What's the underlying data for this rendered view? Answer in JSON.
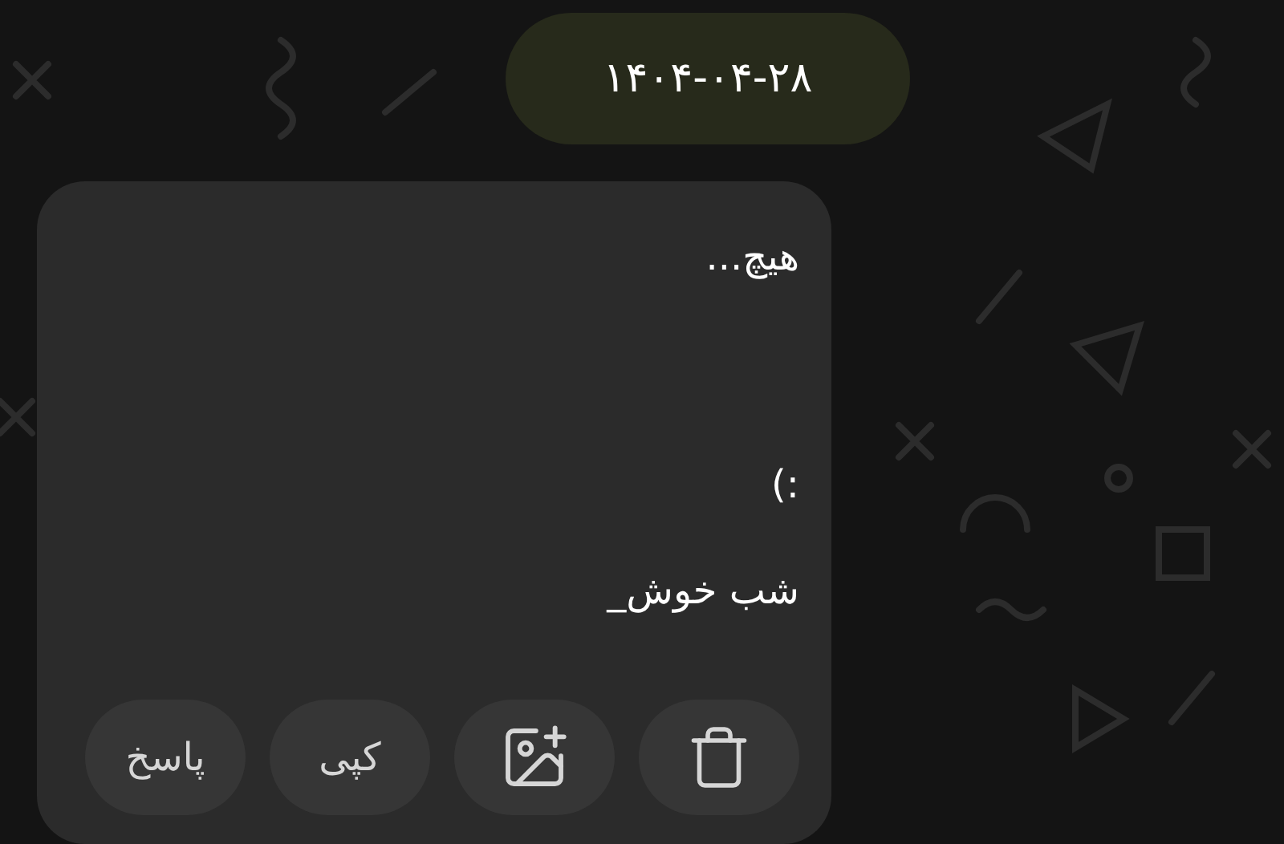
{
  "date_chip": "۱۴۰۴-۰۴-۲۸",
  "message": {
    "lines": [
      {
        "text": "هیچ..."
      },
      {
        "text": ":)"
      },
      {
        "text": "شب خوش_"
      }
    ]
  },
  "actions": [
    {
      "kind": "delete"
    },
    {
      "kind": "add-image"
    },
    {
      "kind": "text",
      "label": "کپی"
    },
    {
      "kind": "text",
      "label": "پاسخ"
    }
  ]
}
